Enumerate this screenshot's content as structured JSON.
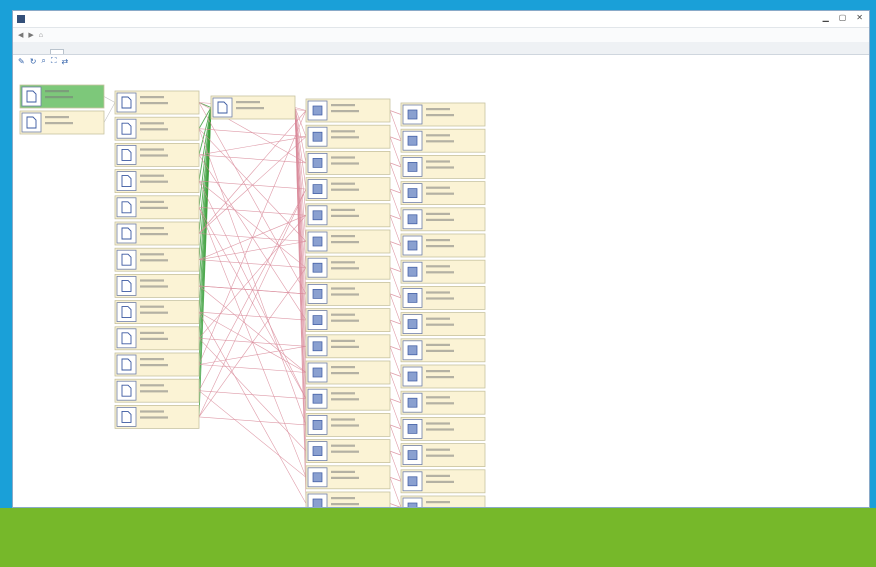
{
  "window": {
    "title": "",
    "address_right": "",
    "tabs": [
      {
        "label": "",
        "active": false
      },
      {
        "label": "",
        "active": false
      },
      {
        "label": "",
        "active": true
      }
    ],
    "hint": ""
  },
  "toolbar": {
    "tools": [
      "pin-icon",
      "refresh-icon",
      "zoom-icon",
      "layout-icon",
      "share-icon"
    ]
  },
  "graph": {
    "node_fill": "#fbf3d5",
    "node_fill_selected": "#7dc87a",
    "node_border": "#c8c3a0",
    "edge_colors": {
      "green": "#3a9e3a",
      "red": "#d98a9a",
      "gray": "#b7b7b7"
    },
    "col0": [
      {
        "selected": true
      },
      {
        "selected": false
      }
    ],
    "col1_count": 13,
    "col2_count": 1,
    "col3_count": 16,
    "col4_count": 16
  },
  "colors": {
    "frame": "#1aa0d8",
    "band": "#76b82a"
  }
}
